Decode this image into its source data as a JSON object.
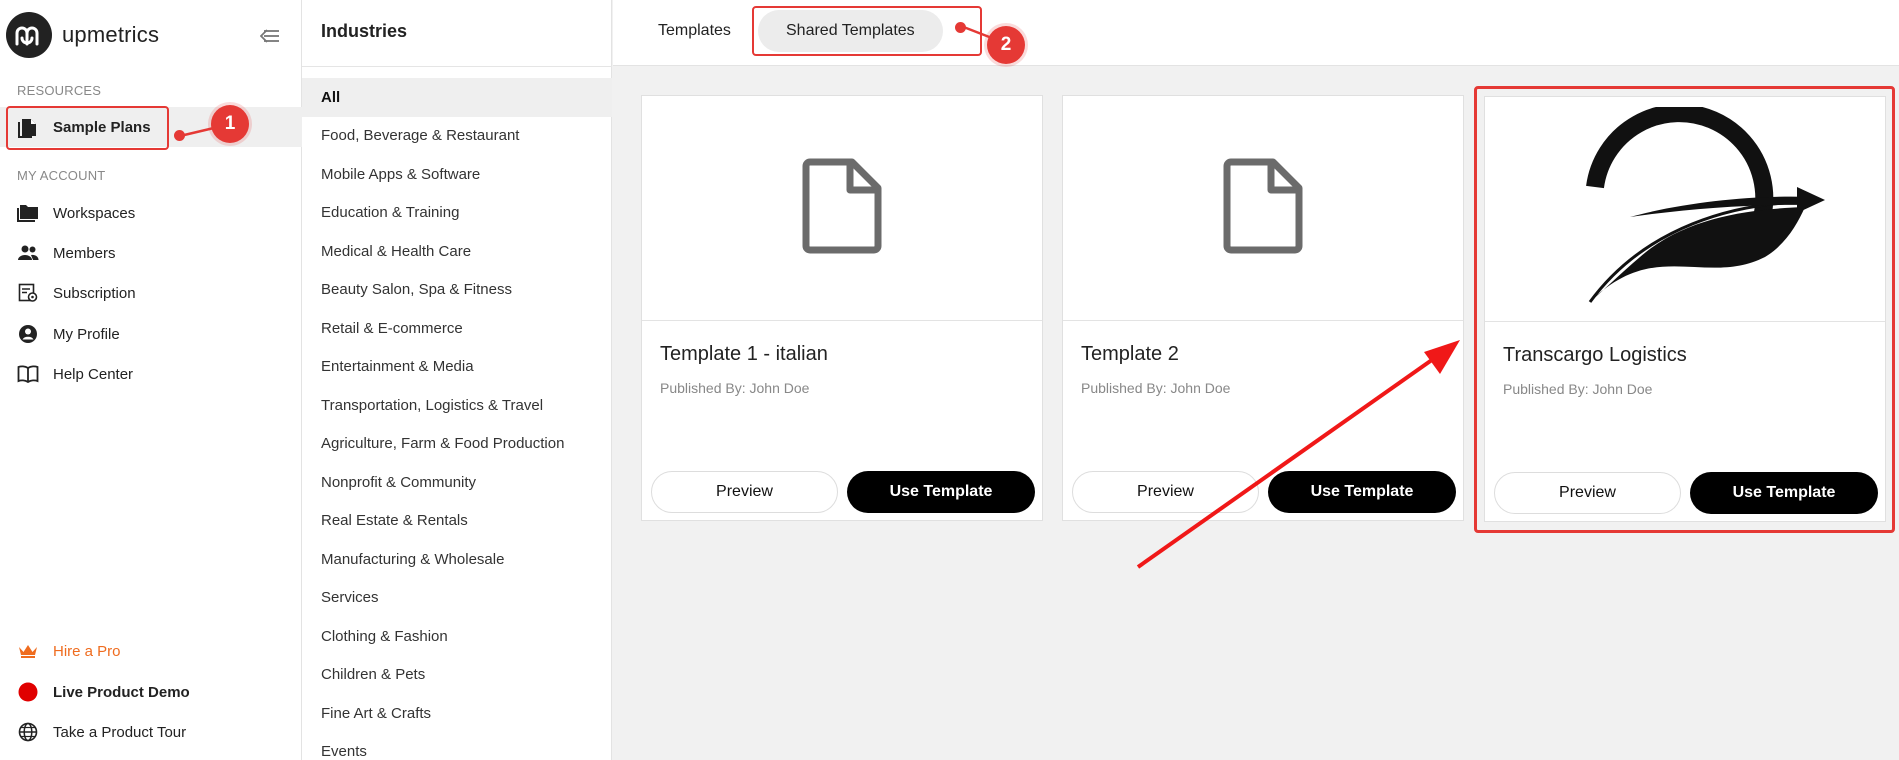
{
  "brand": {
    "name": "upmetrics"
  },
  "sidebar": {
    "resources_label": "RESOURCES",
    "account_label": "MY ACCOUNT",
    "sample_plans": "Sample Plans",
    "account_items": [
      {
        "label": "Workspaces",
        "icon": "folder-icon"
      },
      {
        "label": "Members",
        "icon": "members-icon"
      },
      {
        "label": "Subscription",
        "icon": "subscription-icon"
      },
      {
        "label": "My Profile",
        "icon": "profile-icon"
      },
      {
        "label": "Help Center",
        "icon": "book-icon"
      }
    ],
    "bottom_items": [
      {
        "label": "Hire a Pro",
        "icon": "crown-icon",
        "color": "#ef6c1f"
      },
      {
        "label": "Live Product Demo",
        "icon": "live-dot-icon",
        "color": "#e00000"
      },
      {
        "label": "Take a Product Tour",
        "icon": "globe-icon"
      }
    ]
  },
  "industries": {
    "title": "Industries",
    "items": [
      "All",
      "Food, Beverage & Restaurant",
      "Mobile Apps & Software",
      "Education & Training",
      "Medical & Health Care",
      "Beauty Salon, Spa & Fitness",
      "Retail & E-commerce",
      "Entertainment & Media",
      "Transportation, Logistics & Travel",
      "Agriculture, Farm & Food Production",
      "Nonprofit & Community",
      "Real Estate & Rentals",
      "Manufacturing & Wholesale",
      "Services",
      "Clothing & Fashion",
      "Children & Pets",
      "Fine Art & Crafts",
      "Events"
    ],
    "active": "All"
  },
  "tabs": [
    {
      "label": "Templates",
      "active": false
    },
    {
      "label": "Shared Templates",
      "active": true
    }
  ],
  "cards": [
    {
      "title": "Template 1 - italian",
      "published": "Published By: John Doe",
      "thumb": "document-icon",
      "preview_label": "Preview",
      "use_label": "Use Template"
    },
    {
      "title": "Template 2",
      "published": "Published By: John Doe",
      "thumb": "document-icon",
      "preview_label": "Preview",
      "use_label": "Use Template"
    },
    {
      "title": "Transcargo Logistics",
      "published": "Published By: John Doe",
      "thumb": "transcargo-logo-icon",
      "preview_label": "Preview",
      "use_label": "Use Template"
    }
  ],
  "annotations": {
    "step1": "1",
    "step2": "2",
    "color": "#e53935"
  }
}
